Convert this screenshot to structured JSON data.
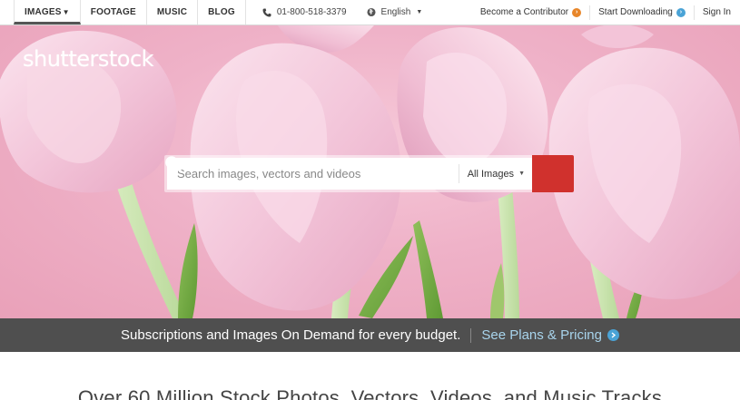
{
  "nav": {
    "items": [
      {
        "label": "IMAGES",
        "active": true
      },
      {
        "label": "FOOTAGE"
      },
      {
        "label": "MUSIC"
      },
      {
        "label": "BLOG"
      }
    ],
    "phone": "01-800-518-3379",
    "language": "English",
    "contributor": "Become a Contributor",
    "start_downloading": "Start Downloading",
    "sign_in": "Sign In",
    "colors": {
      "contributor_icon": "#e8862a",
      "download_icon": "#4aa3d6"
    }
  },
  "hero": {
    "logo": "shutterstock",
    "search": {
      "placeholder": "Search images, vectors and videos",
      "filter": "All Images"
    }
  },
  "promo": {
    "text": "Subscriptions and Images On Demand for every budget.",
    "link": "See Plans & Pricing"
  },
  "headline": "Over 60 Million Stock Photos, Vectors, Videos, and Music Tracks",
  "colors": {
    "search_button": "#d0312d",
    "promo_link": "#a8d4ec"
  }
}
